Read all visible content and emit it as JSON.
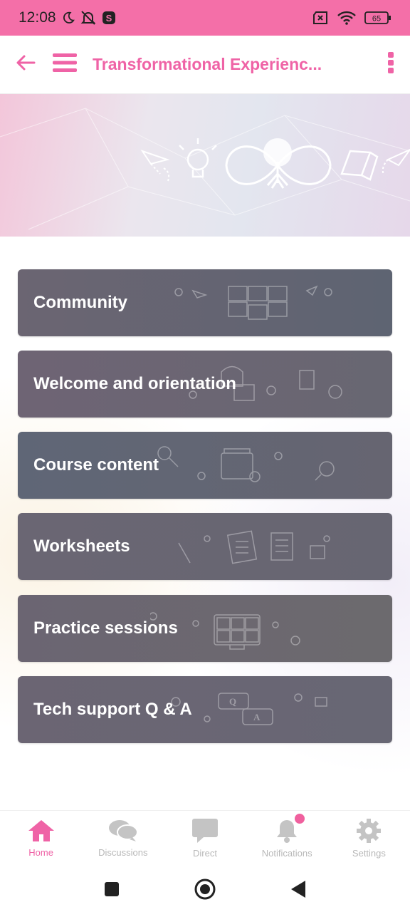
{
  "status_bar": {
    "time": "12:08",
    "battery": "65"
  },
  "app_bar": {
    "title": "Transformational Experienc..."
  },
  "colors": {
    "accent": "#ef63a6",
    "status_bar": "#f46fa8",
    "card": "#686573",
    "inactive_tab": "#b8b8b8"
  },
  "cards": [
    {
      "label": "Community"
    },
    {
      "label": "Welcome and orientation"
    },
    {
      "label": "Course content"
    },
    {
      "label": "Worksheets"
    },
    {
      "label": "Practice sessions"
    },
    {
      "label": "Tech support Q & A"
    }
  ],
  "tabs": [
    {
      "label": "Home",
      "icon": "home-icon",
      "active": true
    },
    {
      "label": "Discussions",
      "icon": "chat-bubbles-icon",
      "active": false
    },
    {
      "label": "Direct",
      "icon": "message-icon",
      "active": false
    },
    {
      "label": "Notifications",
      "icon": "bell-icon",
      "active": false,
      "badge": true
    },
    {
      "label": "Settings",
      "icon": "gear-icon",
      "active": false
    }
  ],
  "hero": {
    "q_letter": "Q",
    "a_letter": "A"
  }
}
